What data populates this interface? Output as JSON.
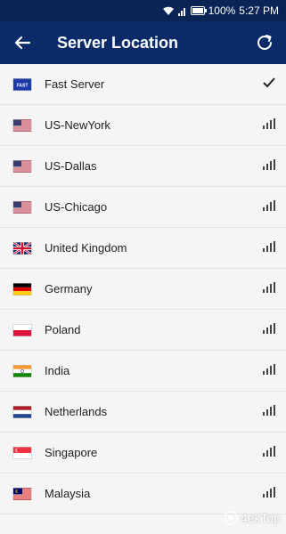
{
  "status_bar": {
    "battery_percent": "100%",
    "time": "5:27 PM"
  },
  "app_bar": {
    "title": "Server Location",
    "back_icon": "arrow-back-icon",
    "refresh_icon": "refresh-icon"
  },
  "servers": [
    {
      "name": "Fast Server",
      "flag": "fast-server-icon",
      "flag_text": "FAST",
      "status": "selected-check-icon"
    },
    {
      "name": "US-NewYork",
      "flag": "us-flag-icon",
      "status": "signal-icon"
    },
    {
      "name": "US-Dallas",
      "flag": "us-flag-icon",
      "status": "signal-icon"
    },
    {
      "name": "US-Chicago",
      "flag": "us-flag-icon",
      "status": "signal-icon"
    },
    {
      "name": "United Kingdom",
      "flag": "uk-flag-icon",
      "status": "signal-icon"
    },
    {
      "name": "Germany",
      "flag": "germany-flag-icon",
      "status": "signal-icon"
    },
    {
      "name": "Poland",
      "flag": "poland-flag-icon",
      "status": "signal-icon"
    },
    {
      "name": "India",
      "flag": "india-flag-icon",
      "status": "signal-icon"
    },
    {
      "name": "Netherlands",
      "flag": "netherlands-flag-icon",
      "status": "signal-icon"
    },
    {
      "name": "Singapore",
      "flag": "singapore-flag-icon",
      "status": "signal-icon"
    },
    {
      "name": "Malaysia",
      "flag": "malaysia-flag-icon",
      "status": "signal-icon"
    }
  ],
  "watermark": {
    "text": "4ekTop"
  },
  "colors": {
    "app_bar": "#0b2a68",
    "status_bar": "#0a2456",
    "background": "#f5f5f5",
    "signal": "#444444"
  }
}
